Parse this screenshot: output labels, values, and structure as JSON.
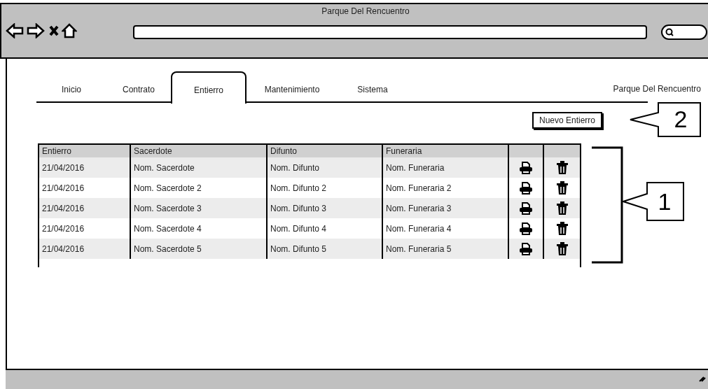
{
  "window": {
    "title": "Parque Del Rencuentro"
  },
  "header_label": "Parque Del Rencuentro",
  "tabs": [
    {
      "label": "Inicio",
      "selected": false
    },
    {
      "label": "Contrato",
      "selected": false
    },
    {
      "label": "Entierro",
      "selected": true
    },
    {
      "label": "Mantenimiento",
      "selected": false
    },
    {
      "label": "Sistema",
      "selected": false
    }
  ],
  "new_button": "Nuevo Entierro",
  "table": {
    "columns": [
      "Entierro",
      "Sacerdote",
      "Difunto",
      "Funeraria"
    ],
    "rows": [
      [
        "21/04/2016",
        "Nom. Sacerdote",
        "Nom. Difunto",
        "Nom. Funeraria"
      ],
      [
        "21/04/2016",
        "Nom. Sacerdote 2",
        "Nom. Difunto 2",
        "Nom. Funeraria 2"
      ],
      [
        "21/04/2016",
        "Nom. Sacerdote 3",
        "Nom. Difunto 3",
        "Nom. Funeraria 3"
      ],
      [
        "21/04/2016",
        "Nom. Sacerdote 4",
        "Nom. Difunto 4",
        "Nom. Funeraria 4"
      ],
      [
        "21/04/2016",
        "Nom. Sacerdote 5",
        "Nom. Difunto 5",
        "Nom. Funeraria 5"
      ]
    ]
  },
  "callouts": [
    {
      "number": "2",
      "kind": "arrow"
    },
    {
      "number": "1",
      "kind": "bracket"
    }
  ]
}
